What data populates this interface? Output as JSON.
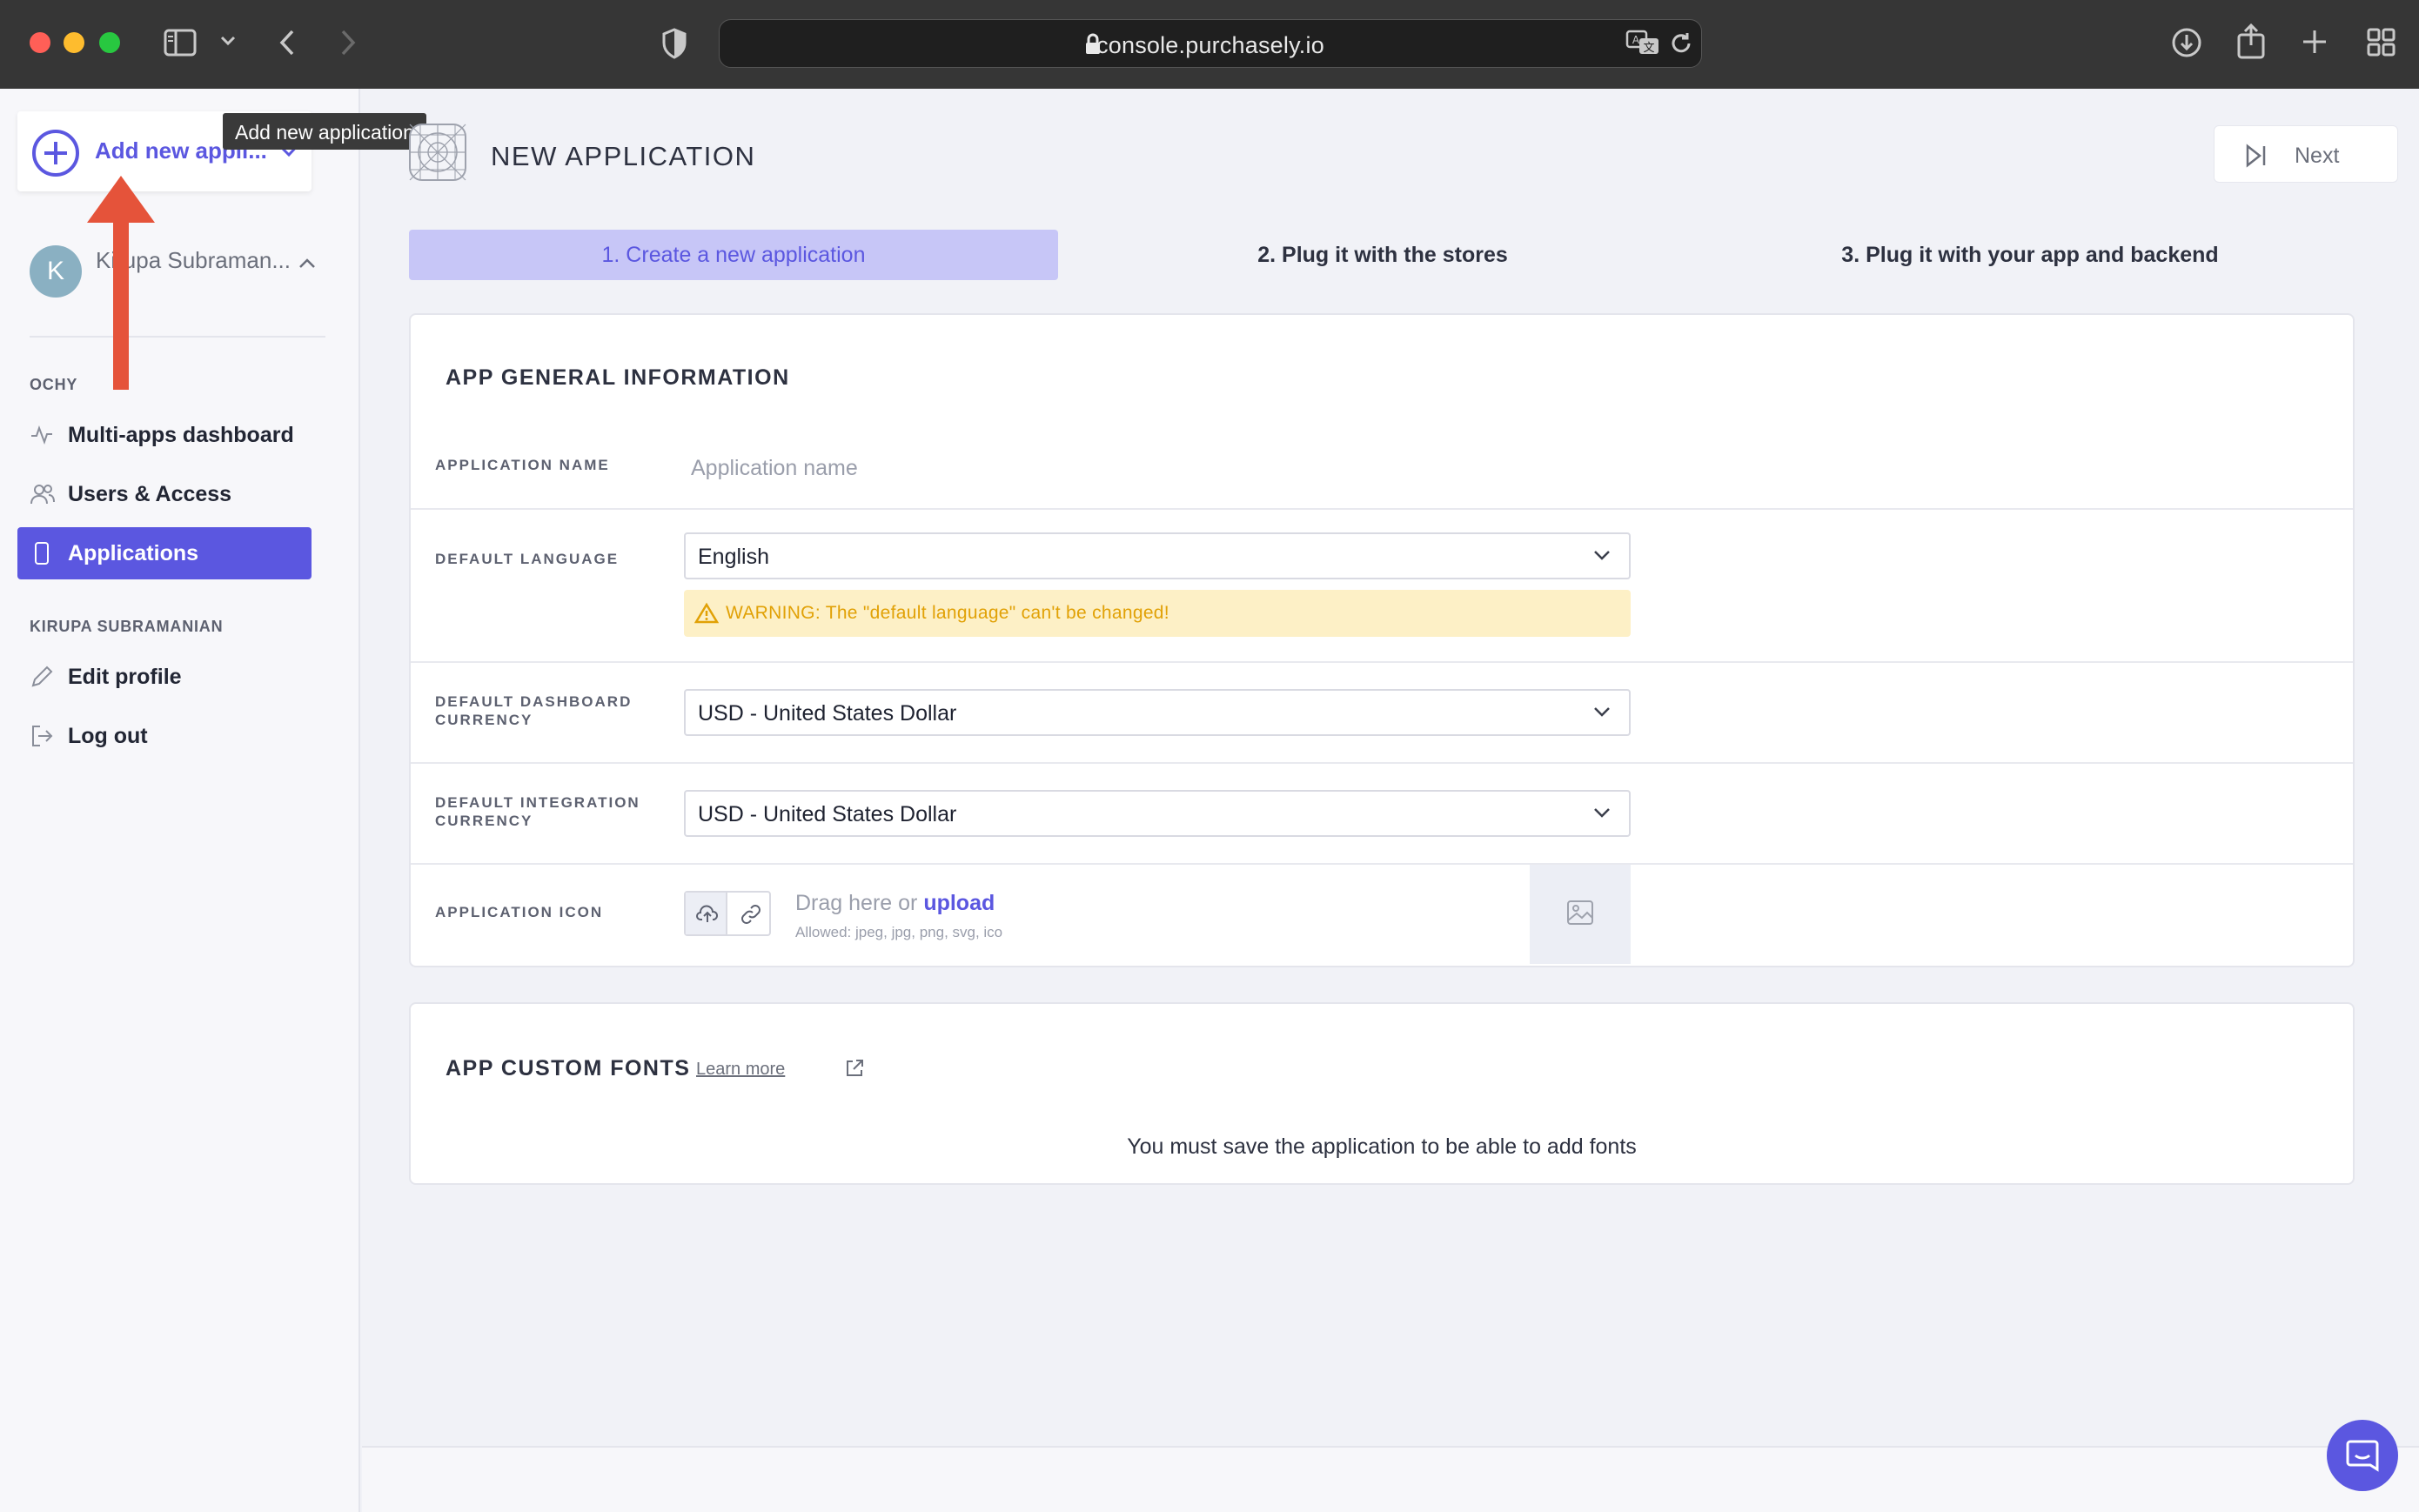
{
  "browser": {
    "url": "console.purchasely.io"
  },
  "sidebar": {
    "add_app_label": "Add new appli...",
    "tooltip": "Add new application",
    "user": {
      "initial": "K",
      "name": "Kirupa Subraman..."
    },
    "org_section": "OCHY",
    "org_items": [
      {
        "label": "Multi-apps dashboard",
        "icon": "activity-icon"
      },
      {
        "label": "Users & Access",
        "icon": "users-icon"
      },
      {
        "label": "Applications",
        "icon": "phone-icon",
        "active": true
      }
    ],
    "user_section": "KIRUPA SUBRAMANIAN",
    "user_items": [
      {
        "label": "Edit profile",
        "icon": "pencil-icon"
      },
      {
        "label": "Log out",
        "icon": "logout-icon"
      }
    ]
  },
  "header": {
    "title": "NEW APPLICATION",
    "next_label": "Next"
  },
  "steps": [
    {
      "label": "1. Create a new application",
      "active": true
    },
    {
      "label": "2. Plug it with the stores",
      "active": false
    },
    {
      "label": "3. Plug it with your app and backend",
      "active": false
    }
  ],
  "general": {
    "title": "APP GENERAL INFORMATION",
    "app_name_label": "APPLICATION NAME",
    "app_name_placeholder": "Application name",
    "language_label": "DEFAULT LANGUAGE",
    "language_value": "English",
    "language_warning": "WARNING: The \"default language\" can't be changed!",
    "dashboard_currency_label": "DEFAULT DASHBOARD CURRENCY",
    "dashboard_currency_value": "USD - United States Dollar",
    "integration_currency_label": "DEFAULT INTEGRATION CURRENCY",
    "integration_currency_value": "USD - United States Dollar",
    "icon_label": "APPLICATION ICON",
    "drag_text": "Drag here or",
    "upload_link": "upload",
    "allowed_text": "Allowed: jpeg, jpg, png, svg, ico"
  },
  "fonts": {
    "title": "APP CUSTOM FONTS",
    "learn_more": "Learn more",
    "message": "You must save the application to be able to add fonts"
  },
  "colors": {
    "accent": "#5b57e0",
    "annotation_arrow": "#e5533a",
    "warning_bg": "#fdf0c6",
    "warning_text": "#e1a106"
  }
}
